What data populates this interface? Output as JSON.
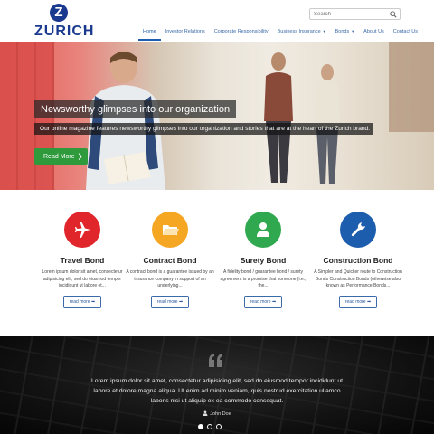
{
  "brand": {
    "name": "ZURICH",
    "mark": "Z",
    "tm": "®"
  },
  "search": {
    "placeholder": "Search"
  },
  "nav": {
    "items": [
      {
        "label": "Home"
      },
      {
        "label": "Investor Relations"
      },
      {
        "label": "Corporate Responsibility"
      },
      {
        "label": "Business Insurance"
      },
      {
        "label": "Bonds"
      },
      {
        "label": "About Us"
      },
      {
        "label": "Contact Us"
      }
    ]
  },
  "hero": {
    "title": "Newsworthy glimpses into our organization",
    "description": "Our online magazine features newsworthy glimpses into our organization and stories that are at the heart of the Zurich brand.",
    "button_label": "Read More"
  },
  "services": [
    {
      "title": "Travel Bond",
      "text": "Lorem ipsum dolor sit amet, consectetur adipisicing elit, sed do eiusmod tempor incididunt ut labore et...",
      "button_label": "read more",
      "color": "#e0252b",
      "icon": "airplane-icon"
    },
    {
      "title": "Contract Bond",
      "text": "A contract bond is a guarantee issued by an insurance company in support of an underlying...",
      "button_label": "read more",
      "color": "#f5a623",
      "icon": "folder-icon"
    },
    {
      "title": "Surety Bond",
      "text": "A fidelity bond / guarantee bond / surety agreement is a promise that someone (i.e., the...",
      "button_label": "read more",
      "color": "#2fa84f",
      "icon": "user-icon"
    },
    {
      "title": "Construction Bond",
      "text": "A Simpler and Quicker route to Construction Bonds Construction Bonds (otherwise also known as Performance Bonds...",
      "button_label": "read more",
      "color": "#1d5dad",
      "icon": "wrench-icon"
    }
  ],
  "testimonial": {
    "quote": "Lorem ipsum dolor sit amet, consectetur adipisicing elit, sed do eiusmod tempor incididunt ut labore et dolore magna aliqua. Ut enim ad minim veniam, quis nostrud exercitation ullamco laboris nisi ut aliquip ex ea commodo consequat.",
    "author": "John Doe",
    "slides": 3,
    "active_slide": 1
  }
}
